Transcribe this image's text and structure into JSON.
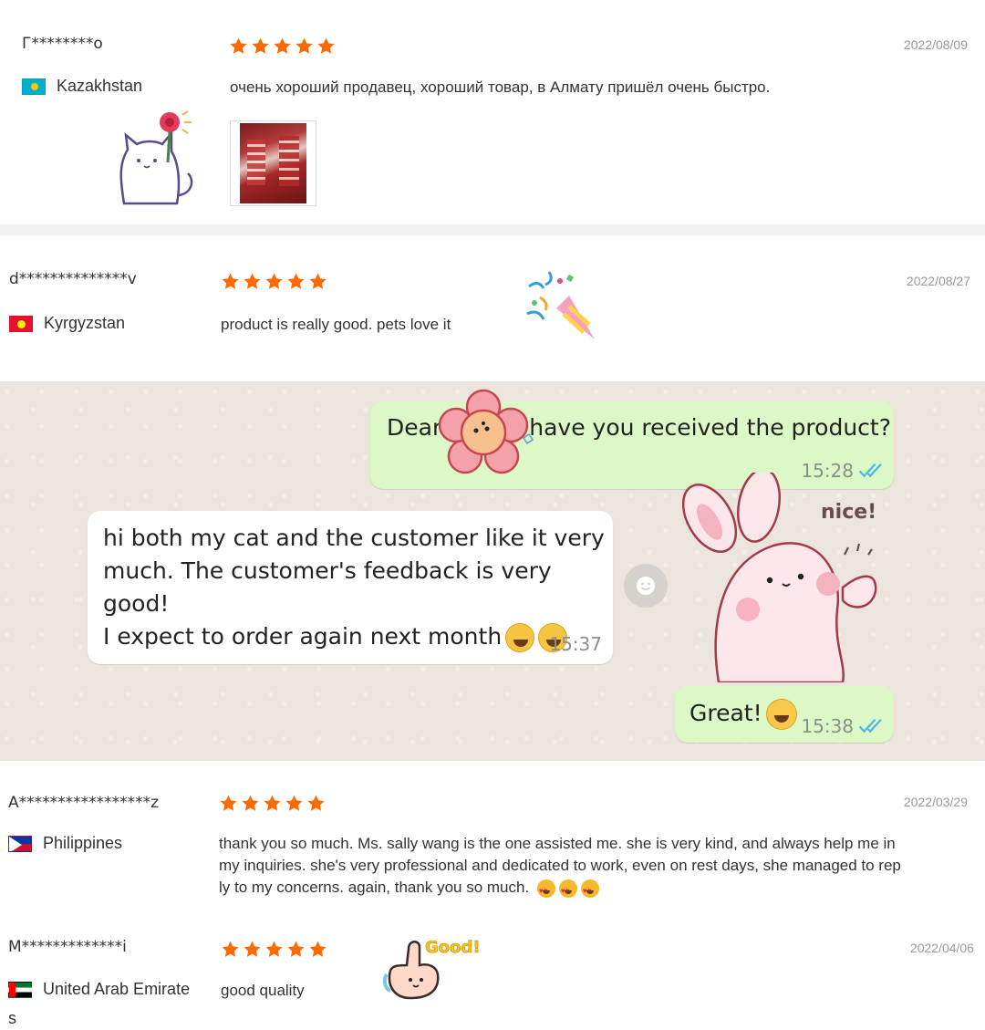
{
  "reviews": [
    {
      "name": "Г********о",
      "country": "Kazakhstan",
      "flag": "kazakhstan-flag",
      "rating": 5,
      "date": "2022/08/09",
      "text": "очень хороший продавец, хороший товар, в Алмату пришёл очень быстро."
    },
    {
      "name": "d**************v",
      "country": "Kyrgyzstan",
      "flag": "kyrgyzstan-flag",
      "rating": 5,
      "date": "2022/08/27",
      "text": "product is really good. pets love it"
    },
    {
      "name": "A*****************z",
      "country": "Philippines",
      "flag": "philippines-flag",
      "rating": 5,
      "date": "2022/03/29",
      "text_lines": [
        "thank you so much. Ms. sally wang is the one assisted me. she is very kind, and always help me in",
        "my inquiries. she's very professional and dedicated to work, even on rest days, she managed to rep",
        "ly to my concerns. again, thank you so much."
      ]
    },
    {
      "name": "M*************i",
      "country_line1": "United Arab Emirate",
      "country_line2": "s",
      "flag": "uae-flag",
      "rating": 5,
      "date": "2022/04/06",
      "text": "good quality"
    }
  ],
  "chat": {
    "msg1_prefix": "Dear",
    "msg1_suffix": "have you received the product?",
    "msg1_time": "15:28",
    "msg2_lines": [
      "hi both my cat and the customer like it very",
      "much. The customer's feedback is very good!",
      "I expect to order again next month"
    ],
    "msg2_time": "15:37",
    "msg3": "Great!",
    "msg3_time": "15:38",
    "sticker_nice": "nice!",
    "sticker_good": "Good!"
  },
  "colors": {
    "star": "#ff6a00",
    "date": "#999999",
    "chat_bg": "#ece5dd",
    "bubble_out": "#dcf8c6",
    "bubble_in": "#ffffff",
    "read_ticks": "#4fb6ec"
  }
}
